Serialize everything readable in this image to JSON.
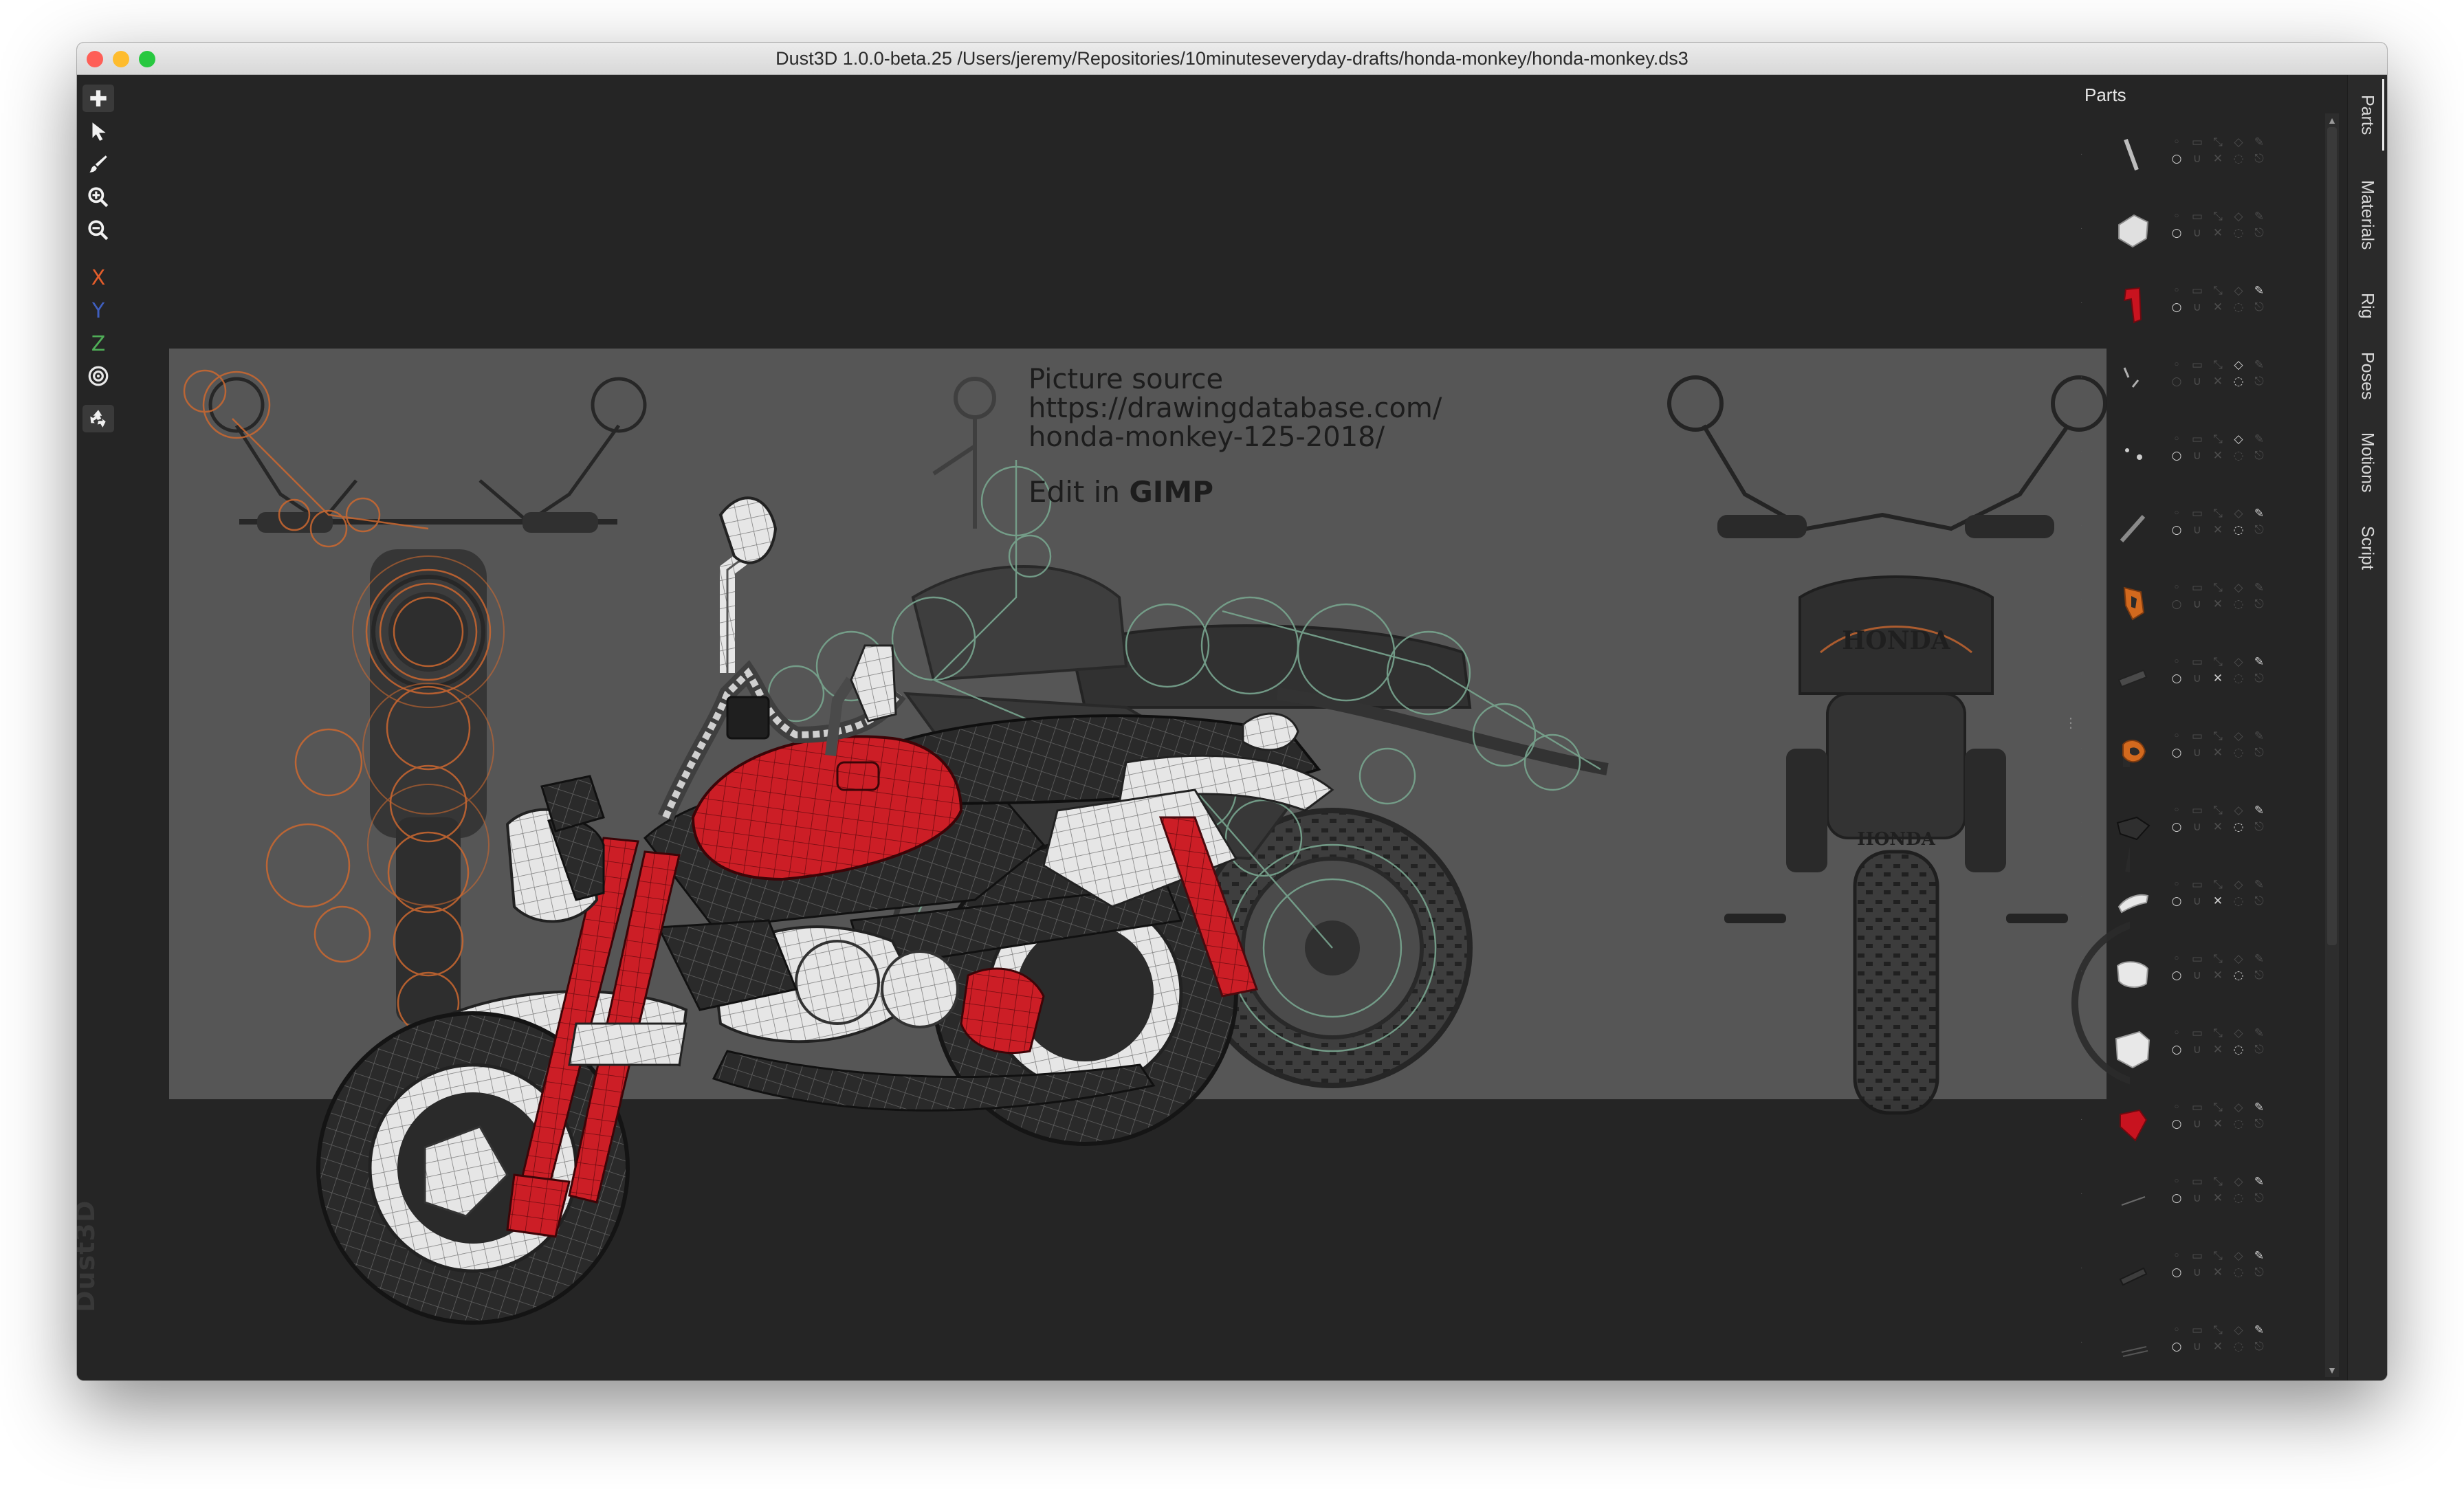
{
  "window": {
    "title": "Dust3D 1.0.0-beta.25 /Users/jeremy/Repositories/10minuteseveryday-drafts/honda-monkey/honda-monkey.ds3",
    "traffic_colors": [
      "#fe5f57",
      "#febc2e",
      "#28c840"
    ]
  },
  "toolbar": {
    "tools": [
      {
        "name": "add-icon",
        "tooltip": "Add"
      },
      {
        "name": "select-arrow-icon",
        "tooltip": "Select"
      },
      {
        "name": "paint-brush-icon",
        "tooltip": "Paint"
      },
      {
        "name": "zoom-in-icon",
        "tooltip": "Zoom in"
      },
      {
        "name": "zoom-out-icon",
        "tooltip": "Zoom out"
      }
    ],
    "axes": [
      {
        "label": "X",
        "color": "#e35d2b"
      },
      {
        "label": "Y",
        "color": "#3f5fbf"
      },
      {
        "label": "Z",
        "color": "#4fae57"
      }
    ],
    "radial_icon": "target-icon",
    "recycle_icon": "recycle-icon",
    "watermark": "Dust3D"
  },
  "reference": {
    "line1": "Picture source",
    "line2": "https://drawingdatabase.com/",
    "line3": "honda-monkey-125-2018/",
    "edit_prefix": "Edit in ",
    "edit_app": "GIMP"
  },
  "parts_panel": {
    "title": "Parts",
    "parts_count": 17,
    "colors": {
      "red_part": "#c8131f",
      "white_part": "#e8e8e8",
      "dark_part": "#3d3d3d",
      "orange_part": "#d2691e"
    }
  },
  "side_tabs": [
    "Parts",
    "Materials",
    "Rig",
    "Poses",
    "Motions",
    "Script"
  ],
  "colors": {
    "background": "#252525",
    "reference_plane": "#565656",
    "moto_red": "#cc1e26",
    "guideline_orange": "#d96a2c",
    "guideline_green": "#7fb49a"
  }
}
